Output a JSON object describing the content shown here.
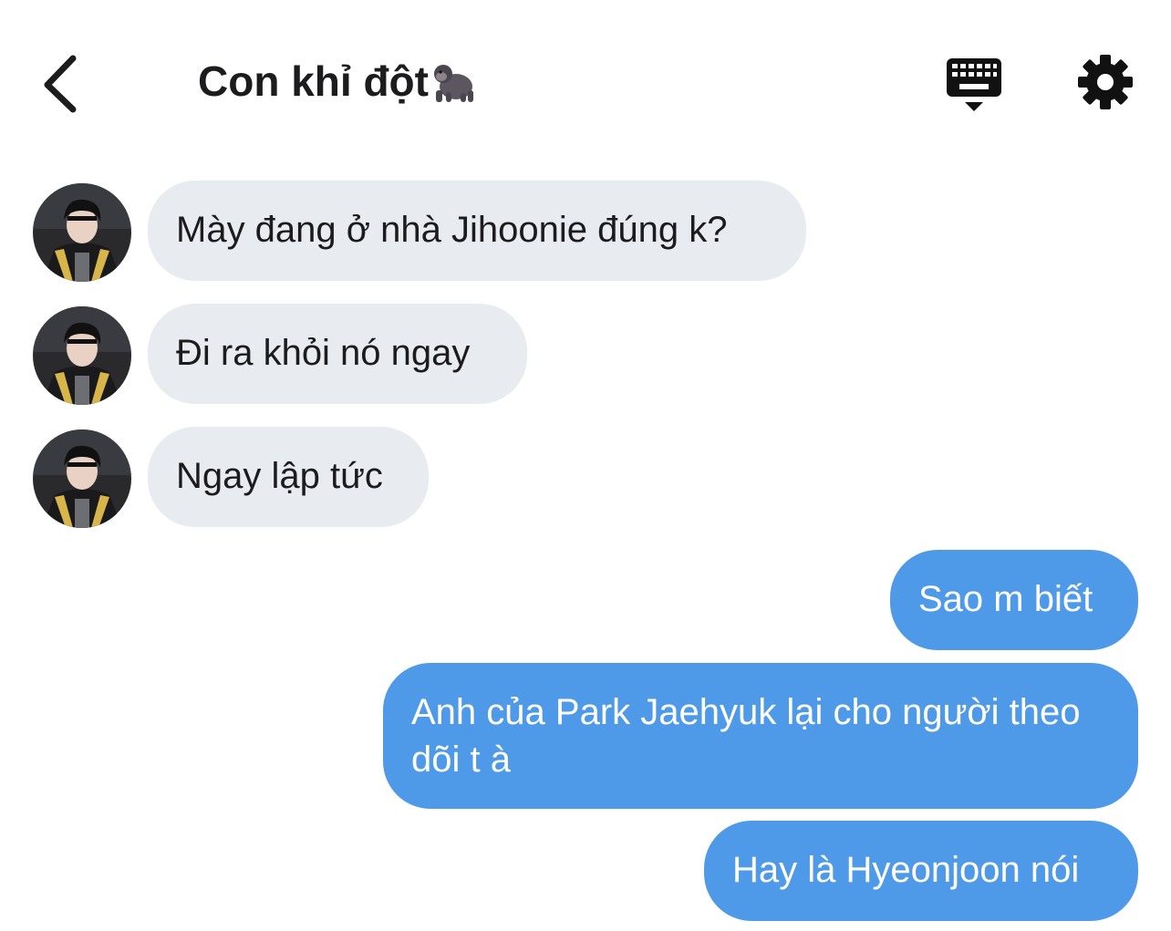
{
  "header": {
    "title": "Con khỉ đột",
    "title_emoji": "gorilla-emoji",
    "back_icon": "chevron-left-icon",
    "keyboard_icon": "keyboard-hide-icon",
    "settings_icon": "gear-icon"
  },
  "messages": [
    {
      "side": "in",
      "text": "Mày đang ở nhà Jihoonie đúng k?"
    },
    {
      "side": "in",
      "text": "Đi ra khỏi nó ngay"
    },
    {
      "side": "in",
      "text": "Ngay lập tức"
    },
    {
      "side": "out",
      "text": "Sao m biết"
    },
    {
      "side": "out",
      "text": "Anh của Park Jaehyuk lại cho người theo dõi t à"
    },
    {
      "side": "out",
      "text": "Hay là Hyeonjoon nói"
    }
  ],
  "colors": {
    "incoming_bubble": "#e8ecf0",
    "outgoing_bubble": "#4f9ae8",
    "title_text": "#1c1c1e"
  }
}
